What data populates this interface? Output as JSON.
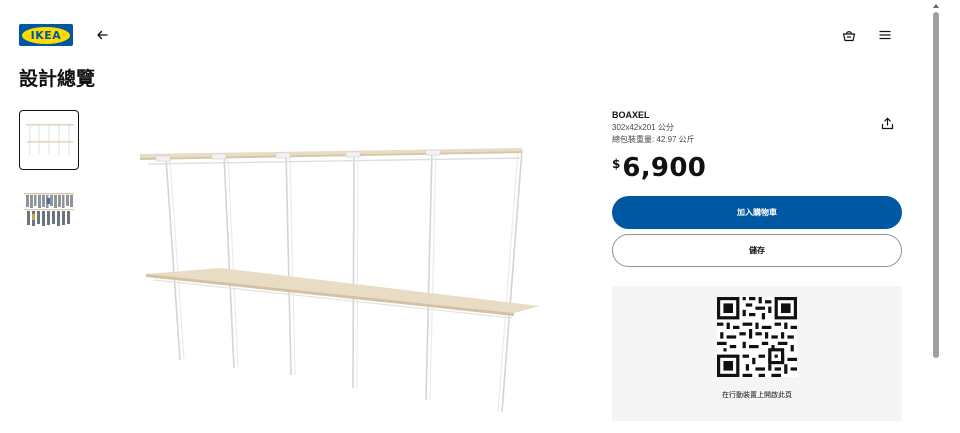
{
  "brand": {
    "logo_text": "IKEA",
    "logo_bg": "#0058a3",
    "logo_accent": "#ffdb00"
  },
  "header": {
    "back_icon": "arrow-left-icon",
    "basket_icon": "shopping-basket-icon",
    "menu_icon": "hamburger-menu-icon"
  },
  "page": {
    "title": "設計總覽"
  },
  "thumbnails": [
    {
      "name": "shelf-render",
      "selected": true
    },
    {
      "name": "shelf-with-clothes",
      "selected": false
    }
  ],
  "product": {
    "name": "BOAXEL",
    "dimensions": "302x42x201 公分",
    "weight": "總包裝重量: 42.97 公斤",
    "currency": "$",
    "price": "6,900",
    "share_icon": "share-upload-icon"
  },
  "actions": {
    "add_to_cart": "加入購物車",
    "save": "儲存"
  },
  "qr": {
    "caption": "在行動裝置上開啟此頁"
  },
  "colors": {
    "primary": "#0058a3",
    "panel": "#f5f5f5",
    "wood": "#e8dcc4"
  }
}
